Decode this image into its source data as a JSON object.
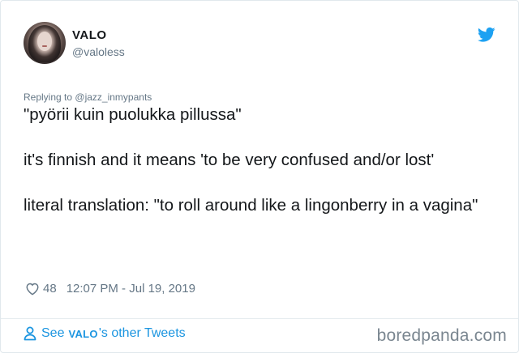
{
  "tweet": {
    "author_name": "VALO",
    "author_handle": "@valoless",
    "replying_prefix": "Replying to",
    "replying_handle": "@jazz_inmypants",
    "paragraphs": [
      "\"pyörii kuin puolukka pillussa\"",
      "it's finnish and it means 'to be very confused and/or lost'",
      "literal translation: \"to roll around like a lingonberry in a vagina\""
    ],
    "likes": "48",
    "timestamp": "12:07 PM - Jul 19, 2019"
  },
  "footer": {
    "see_prefix": "See",
    "see_name": "VALO",
    "see_suffix": "'s other Tweets",
    "watermark": "boredpanda.com"
  },
  "icons": {
    "brand": "twitter-bird-icon",
    "like": "heart-icon",
    "profile": "person-icon"
  },
  "colors": {
    "twitter_blue": "#1da1f2",
    "link_blue": "#1b95e0",
    "secondary_text": "#657786",
    "primary_text": "#14171a"
  }
}
